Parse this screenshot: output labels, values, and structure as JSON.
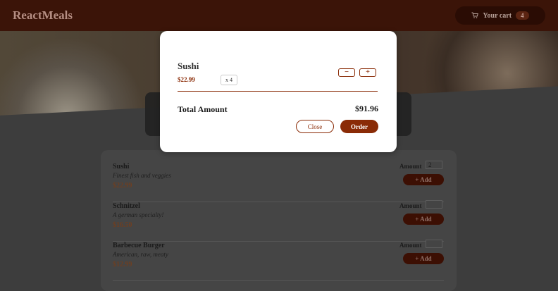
{
  "header": {
    "brand": "ReactMeals",
    "cart_label": "Your cart",
    "cart_count": "4"
  },
  "meals": [
    {
      "name": "Sushi",
      "description": "Finest fish and veggies",
      "price": "$22.99",
      "amount_label": "Amount",
      "amount_value": "2",
      "add_label": "+ Add"
    },
    {
      "name": "Schnitzel",
      "description": "A german specialty!",
      "price": "$16.50",
      "amount_label": "Amount",
      "amount_value": "",
      "add_label": "+ Add"
    },
    {
      "name": "Barbecue Burger",
      "description": "American, raw, meaty",
      "price": "$12.99",
      "amount_label": "Amount",
      "amount_value": "",
      "add_label": "+ Add"
    }
  ],
  "modal": {
    "item": {
      "name": "Sushi",
      "price": "$22.99",
      "quantity": "x 4",
      "minus": "−",
      "plus": "+"
    },
    "total_label": "Total Amount",
    "total_amount": "$91.96",
    "close_label": "Close",
    "order_label": "Order"
  }
}
